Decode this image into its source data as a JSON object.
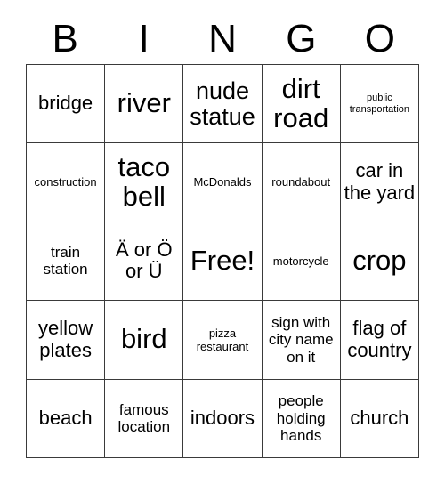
{
  "card": {
    "header": {
      "letters": [
        "B",
        "I",
        "N",
        "G",
        "O"
      ]
    },
    "rows": [
      [
        {
          "text": "bridge",
          "size": "fs-lg"
        },
        {
          "text": "river",
          "size": "fs-xxl"
        },
        {
          "text": "nude statue",
          "size": "fs-xl"
        },
        {
          "text": "dirt road",
          "size": "fs-xxl"
        },
        {
          "text": "public transportation",
          "size": "fs-xs"
        }
      ],
      [
        {
          "text": "construction",
          "size": "fs-sm"
        },
        {
          "text": "taco bell",
          "size": "fs-xxl"
        },
        {
          "text": "McDonalds",
          "size": "fs-sm"
        },
        {
          "text": "roundabout",
          "size": "fs-sm"
        },
        {
          "text": "car in the yard",
          "size": "fs-lg"
        }
      ],
      [
        {
          "text": "train station",
          "size": "fs-md"
        },
        {
          "text": "Ä or Ö or Ü",
          "size": "fs-lg"
        },
        {
          "text": "Free!",
          "size": "fs-xxl"
        },
        {
          "text": "motorcycle",
          "size": "fs-sm"
        },
        {
          "text": "crop",
          "size": "fs-xxl"
        }
      ],
      [
        {
          "text": "yellow plates",
          "size": "fs-lg"
        },
        {
          "text": "bird",
          "size": "fs-xxl"
        },
        {
          "text": "pizza restaurant",
          "size": "fs-sm"
        },
        {
          "text": "sign with city name on it",
          "size": "fs-md"
        },
        {
          "text": "flag of country",
          "size": "fs-lg"
        }
      ],
      [
        {
          "text": "beach",
          "size": "fs-lg"
        },
        {
          "text": "famous location",
          "size": "fs-md"
        },
        {
          "text": "indoors",
          "size": "fs-lg"
        },
        {
          "text": "people holding hands",
          "size": "fs-md"
        },
        {
          "text": "church",
          "size": "fs-lg"
        }
      ]
    ]
  },
  "colors": {
    "background": "#ffffff",
    "text": "#000000",
    "grid_line": "#3a3a3a"
  }
}
